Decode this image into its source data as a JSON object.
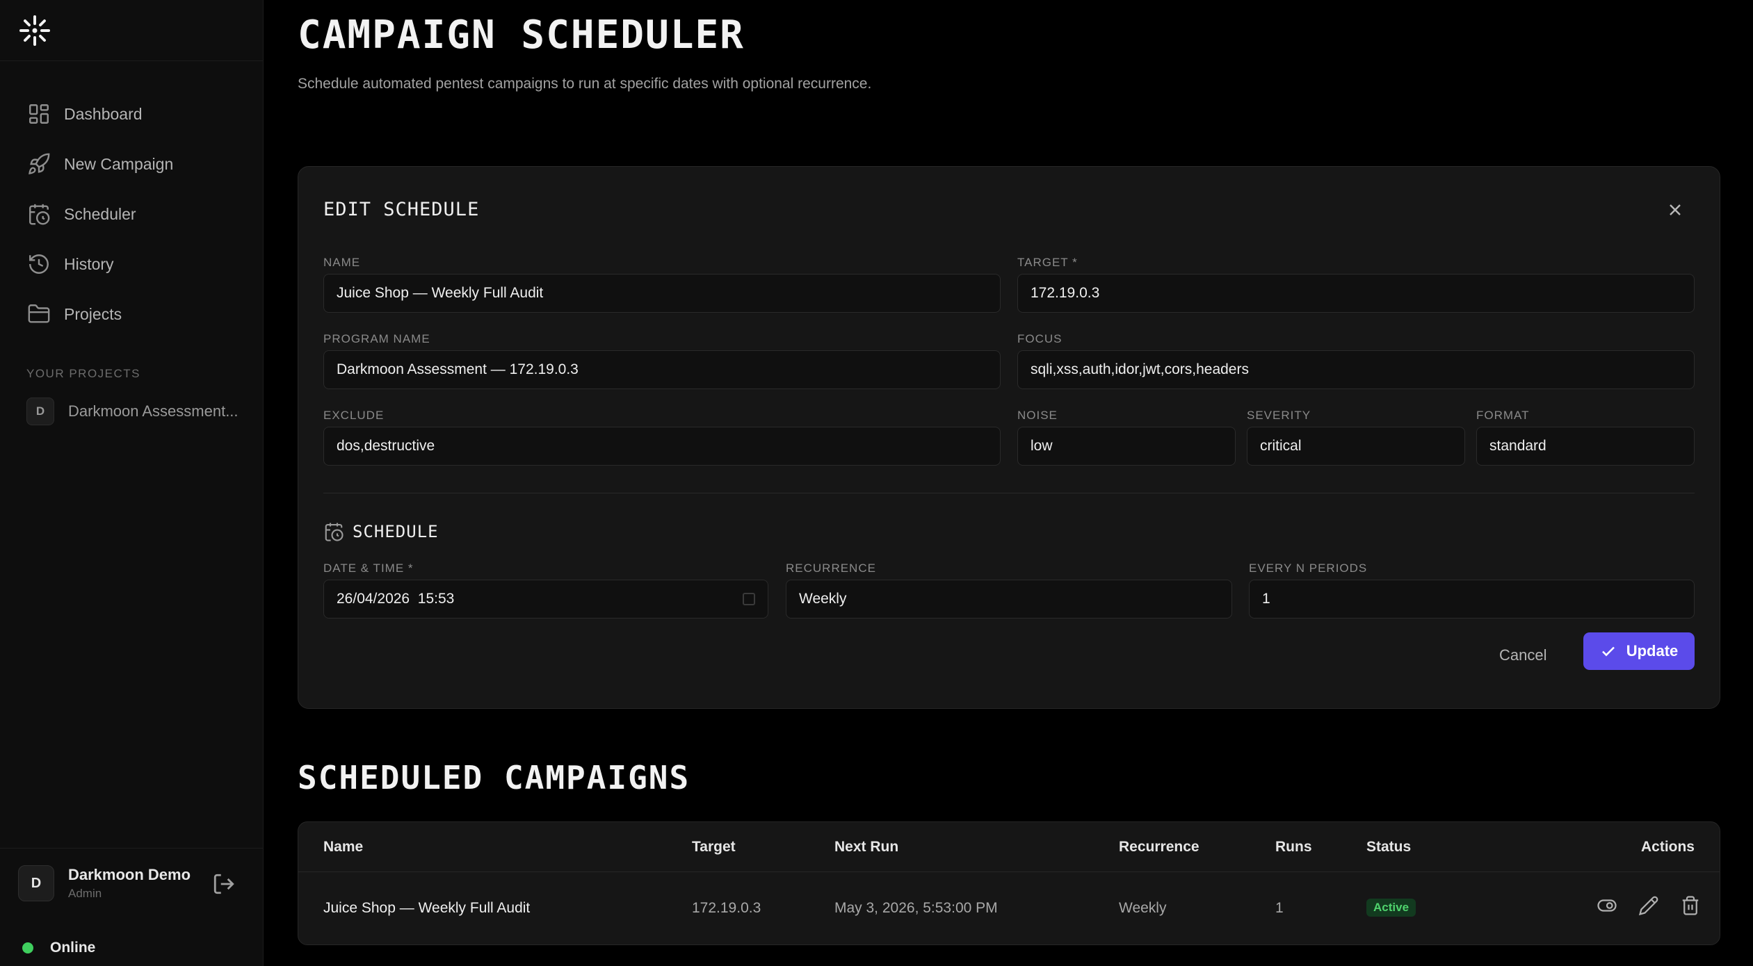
{
  "sidebar": {
    "nav": [
      {
        "label": "Dashboard",
        "icon": "dashboard-icon"
      },
      {
        "label": "New Campaign",
        "icon": "rocket-icon"
      },
      {
        "label": "Scheduler",
        "icon": "calendar-clock-icon"
      },
      {
        "label": "History",
        "icon": "history-icon"
      },
      {
        "label": "Projects",
        "icon": "folder-icon"
      }
    ],
    "projects_label": "YOUR PROJECTS",
    "projects": [
      {
        "initial": "D",
        "name": "Darkmoon Assessment..."
      }
    ],
    "user": {
      "initial": "D",
      "name": "Darkmoon Demo",
      "role": "Admin"
    },
    "status": "Online"
  },
  "header": {
    "title": "CAMPAIGN SCHEDULER",
    "subtitle": "Schedule automated pentest campaigns to run at specific dates with optional recurrence."
  },
  "edit": {
    "title": "EDIT SCHEDULE",
    "fields": {
      "name": {
        "label": "NAME",
        "value": "Juice Shop — Weekly Full Audit"
      },
      "target": {
        "label": "TARGET *",
        "value": "172.19.0.3"
      },
      "program": {
        "label": "PROGRAM NAME",
        "value": "Darkmoon Assessment — 172.19.0.3"
      },
      "focus": {
        "label": "FOCUS",
        "value": "sqli,xss,auth,idor,jwt,cors,headers"
      },
      "exclude": {
        "label": "EXCLUDE",
        "value": "dos,destructive"
      },
      "noise": {
        "label": "NOISE",
        "value": "low"
      },
      "severity": {
        "label": "SEVERITY",
        "value": "critical"
      },
      "format": {
        "label": "FORMAT",
        "value": "standard"
      }
    },
    "schedule": {
      "title": "SCHEDULE",
      "datetime": {
        "label": "DATE & TIME *",
        "value": "26/04/2026  15:53"
      },
      "recurrence": {
        "label": "RECURRENCE",
        "value": "Weekly"
      },
      "periods": {
        "label": "EVERY N PERIODS",
        "value": "1"
      }
    },
    "cancel_label": "Cancel",
    "update_label": "Update",
    "accent": "#5b4bea"
  },
  "table": {
    "title": "SCHEDULED CAMPAIGNS",
    "columns": [
      "Name",
      "Target",
      "Next Run",
      "Recurrence",
      "Runs",
      "Status",
      "Actions"
    ],
    "rows": [
      {
        "name": "Juice Shop — Weekly Full Audit",
        "target": "172.19.0.3",
        "next_run": "May 3, 2026, 5:53:00 PM",
        "recurrence": "Weekly",
        "runs": "1",
        "status": "Active"
      }
    ]
  }
}
